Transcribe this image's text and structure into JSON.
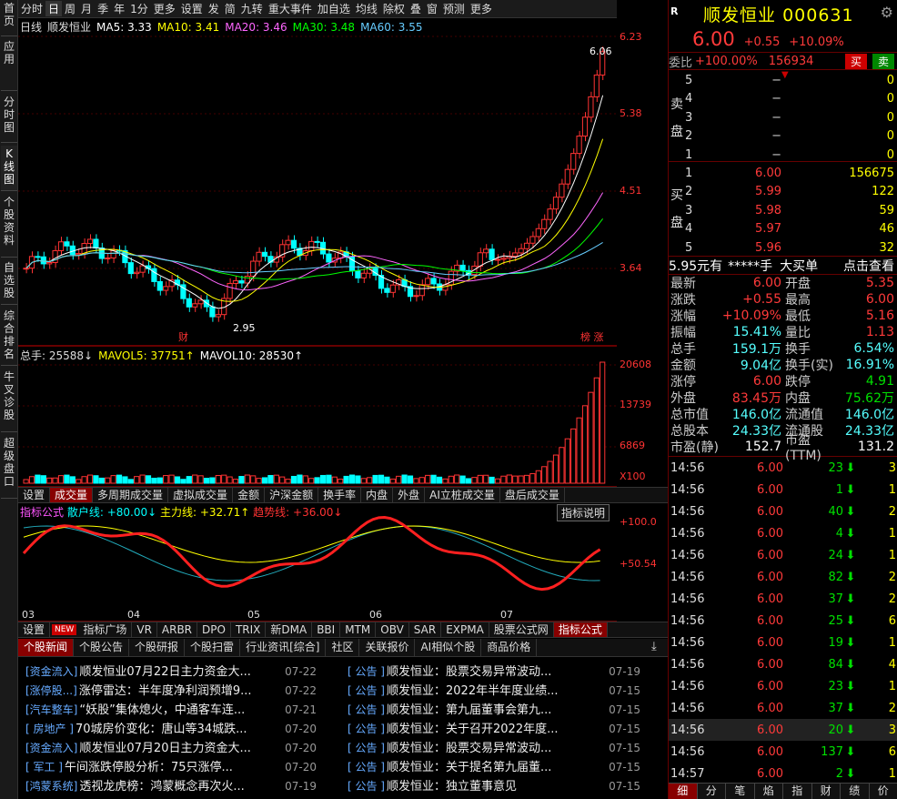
{
  "sidebar": [
    "首页",
    "应用",
    "分时图",
    "K线图",
    "个股资料",
    "自选股",
    "综合排名",
    "牛叉诊股",
    "超级盘口"
  ],
  "toolbar": [
    "分时",
    "日",
    "周",
    "月",
    "季",
    "年",
    "1分",
    "更多",
    "设置",
    "发",
    "简",
    "九转",
    "重大事件",
    "加自选",
    "均线",
    "除权",
    "叠",
    "窗",
    "预测",
    "更多"
  ],
  "kline": {
    "legend": [
      {
        "t": "日线",
        "c": "#ddd"
      },
      {
        "t": "顺发恒业",
        "c": "#ddd"
      },
      {
        "t": "MA5: 3.33",
        "c": "#fff"
      },
      {
        "t": "MA10: 3.41",
        "c": "#ffff00"
      },
      {
        "t": "MA20: 3.46",
        "c": "#ff66ff"
      },
      {
        "t": "MA30: 3.48",
        "c": "#00ff00"
      },
      {
        "t": "MA60: 3.55",
        "c": "#66ccff"
      }
    ],
    "axis": [
      "6.23",
      "5.38",
      "4.51",
      "3.64"
    ],
    "high": "6.06",
    "low": "2.95",
    "tag_left": "财",
    "tag_right": "榜 涨"
  },
  "volume": {
    "legend": [
      {
        "t": "总手: 25588↓",
        "c": "#ddd"
      },
      {
        "t": "MAVOL5: 37751↑",
        "c": "#ffff00"
      },
      {
        "t": "MAVOL10: 28530↑",
        "c": "#fff"
      }
    ],
    "axis": [
      "20608",
      "13739",
      "6869",
      "X100"
    ]
  },
  "tabs1": [
    "设置",
    "成交量",
    "多周期成交量",
    "虚拟成交量",
    "金额",
    "沪深金额",
    "换手率",
    "内盘",
    "外盘",
    "AI立桩成交量",
    "盘后成交量"
  ],
  "indicator": {
    "title": "指标公式",
    "l1": "散户线: +80.00↓",
    "l2": "主力线: +32.71↑",
    "l3": "趋势线: +36.00↓",
    "btn": "指标说明",
    "axis": [
      "+100.0",
      "+50.54"
    ],
    "months": [
      "03",
      "04",
      "05",
      "06",
      "07"
    ]
  },
  "tabs2": [
    "设置",
    "NEW",
    "指标广场",
    "VR",
    "ARBR",
    "DPO",
    "TRIX",
    "新DMA",
    "BBI",
    "MTM",
    "OBV",
    "SAR",
    "EXPMA",
    "股票公式网",
    "指标公式"
  ],
  "newstabs": [
    "个股新闻",
    "个股公告",
    "个股研报",
    "个股扫雷",
    "行业资讯[综合]",
    "社区",
    "关联报价",
    "AI相似个股",
    "商品价格"
  ],
  "news_left": [
    {
      "tag": "[资金流入]",
      "t": "顺发恒业07月22日主力资金大...",
      "d": "07-22"
    },
    {
      "tag": "[涨停股...]",
      "t": "涨停雷达：半年度净利润预增9...",
      "d": "07-22"
    },
    {
      "tag": "[汽车整车]",
      "t": "“妖股”集体熄火，中通客车连...",
      "d": "07-21"
    },
    {
      "tag": "[ 房地产 ]",
      "t": "70城房价变化：唐山等34城跌...",
      "d": "07-20"
    },
    {
      "tag": "[资金流入]",
      "t": "顺发恒业07月20日主力资金大...",
      "d": "07-20"
    },
    {
      "tag": "[ 军工 ]",
      "t": "午间涨跌停股分析：75只涨停...",
      "d": "07-20"
    },
    {
      "tag": "[鸿蒙系统]",
      "t": "透视龙虎榜：鸿蒙概念再次火...",
      "d": "07-19"
    }
  ],
  "news_right": [
    {
      "tag": "[ 公告 ]",
      "t": "顺发恒业：股票交易异常波动...",
      "d": "07-19"
    },
    {
      "tag": "[ 公告 ]",
      "t": "顺发恒业：2022年半年度业绩...",
      "d": "07-15"
    },
    {
      "tag": "[ 公告 ]",
      "t": "顺发恒业：第九届董事会第九...",
      "d": "07-15"
    },
    {
      "tag": "[ 公告 ]",
      "t": "顺发恒业：关于召开2022年度...",
      "d": "07-15"
    },
    {
      "tag": "[ 公告 ]",
      "t": "顺发恒业：股票交易异常波动...",
      "d": "07-15"
    },
    {
      "tag": "[ 公告 ]",
      "t": "顺发恒业：关于提名第九届董...",
      "d": "07-15"
    },
    {
      "tag": "[ 公告 ]",
      "t": "顺发恒业：独立董事意见",
      "d": "07-15"
    }
  ],
  "quote": {
    "r": "R",
    "name": "顺发恒业",
    "code": "000631",
    "price": "6.00",
    "chg": "+0.55",
    "pct": "+10.09%",
    "wb_label": "委比",
    "wb": "+100.00%",
    "wc": "156934",
    "buy": "买",
    "sell": "卖"
  },
  "asks": [
    {
      "n": "5",
      "p": "−",
      "v": "0"
    },
    {
      "n": "4",
      "p": "−",
      "v": "0"
    },
    {
      "n": "3",
      "p": "−",
      "v": "0"
    },
    {
      "n": "2",
      "p": "−",
      "v": "0"
    },
    {
      "n": "1",
      "p": "−",
      "v": "0"
    }
  ],
  "bids": [
    {
      "n": "1",
      "p": "6.00",
      "v": "156675"
    },
    {
      "n": "2",
      "p": "5.99",
      "v": "122"
    },
    {
      "n": "3",
      "p": "5.98",
      "v": "59"
    },
    {
      "n": "4",
      "p": "5.97",
      "v": "46"
    },
    {
      "n": "5",
      "p": "5.96",
      "v": "32"
    }
  ],
  "ask_label": [
    "卖",
    "盘"
  ],
  "bid_label": [
    "买",
    "盘"
  ],
  "bigorder": {
    "a": "5.95元有",
    "b": "*****手",
    "c": "大买单",
    "d": "点击查看"
  },
  "stats": [
    [
      "最新",
      "6.00",
      "开盘",
      "5.35"
    ],
    [
      "涨跌",
      "+0.55",
      "最高",
      "6.00"
    ],
    [
      "涨幅",
      "+10.09%",
      "最低",
      "5.16"
    ],
    [
      "振幅",
      "15.41%",
      "量比",
      "1.13"
    ],
    [
      "总手",
      "159.1万",
      "换手",
      "6.54%"
    ],
    [
      "金额",
      "9.04亿",
      "换手(实)",
      "16.91%"
    ],
    [
      "涨停",
      "6.00",
      "跌停",
      "4.91"
    ],
    [
      "外盘",
      "83.45万",
      "内盘",
      "75.62万"
    ],
    [
      "总市值",
      "146.0亿",
      "流通值",
      "146.0亿"
    ],
    [
      "总股本",
      "24.33亿",
      "流通股",
      "24.33亿"
    ],
    [
      "市盈(静)",
      "152.7",
      "市盈(TTM)",
      "131.2"
    ]
  ],
  "ticks": [
    [
      "14:56",
      "6.00",
      "23",
      "3"
    ],
    [
      "14:56",
      "6.00",
      "1",
      "1"
    ],
    [
      "14:56",
      "6.00",
      "40",
      "2"
    ],
    [
      "14:56",
      "6.00",
      "4",
      "1"
    ],
    [
      "14:56",
      "6.00",
      "24",
      "1"
    ],
    [
      "14:56",
      "6.00",
      "82",
      "2"
    ],
    [
      "14:56",
      "6.00",
      "37",
      "2"
    ],
    [
      "14:56",
      "6.00",
      "25",
      "6"
    ],
    [
      "14:56",
      "6.00",
      "19",
      "1"
    ],
    [
      "14:56",
      "6.00",
      "84",
      "4"
    ],
    [
      "14:56",
      "6.00",
      "23",
      "1"
    ],
    [
      "14:56",
      "6.00",
      "37",
      "2"
    ],
    [
      "14:56",
      "6.00",
      "20",
      "3"
    ],
    [
      "14:56",
      "6.00",
      "137",
      "6"
    ],
    [
      "14:57",
      "6.00",
      "2",
      "1"
    ]
  ],
  "bottomtabs": [
    "细",
    "分",
    "笔",
    "焰",
    "指",
    "财",
    "绩",
    "价"
  ]
}
